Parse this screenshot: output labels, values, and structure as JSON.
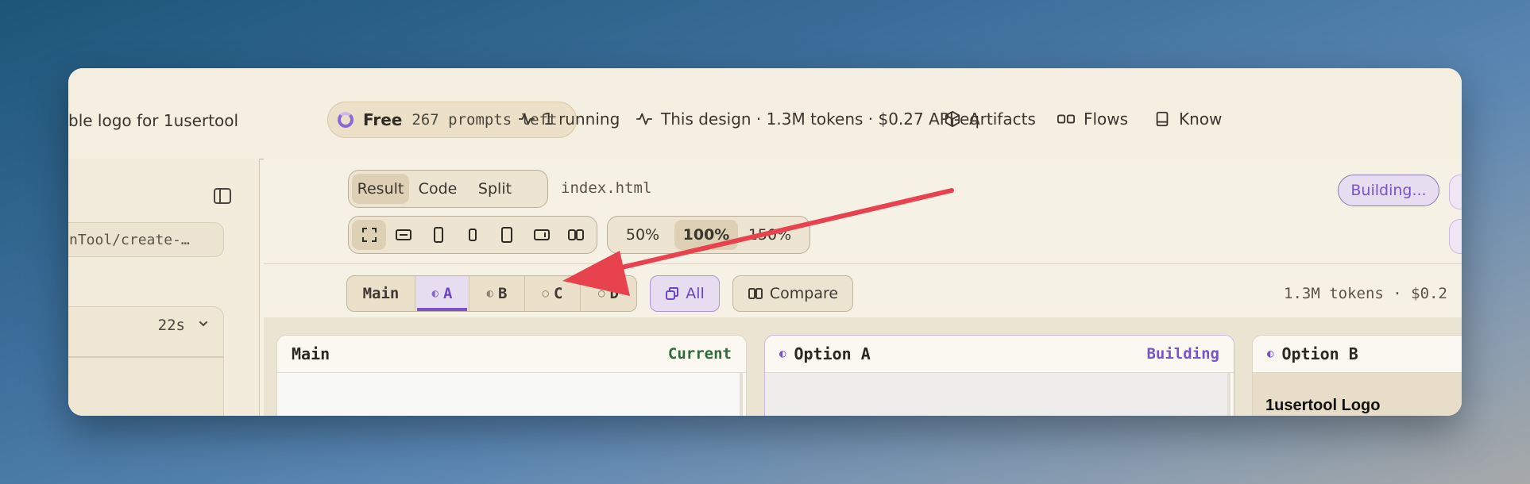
{
  "topbar": {
    "project_title": "ble logo for 1usertool",
    "plan": {
      "name": "Free",
      "remaining": "267 prompts left"
    },
    "running": "1 running",
    "design_stats": "This design · 1.3M tokens · $0.27 API-eq",
    "artifacts": "Artifacts",
    "flows": "Flows",
    "knowledge": "Know"
  },
  "sidebar": {
    "path": "nTool/create-…",
    "run_duration": "22s"
  },
  "toolbar": {
    "view_tabs": [
      "Result",
      "Code",
      "Split"
    ],
    "active_view": "Result",
    "file": "index.html",
    "zoom_options": [
      "50%",
      "100%",
      "150%"
    ],
    "active_zoom": "100%",
    "build_status": "Building...",
    "device_icons": [
      "fullscreen-icon",
      "fit-width-icon",
      "phone-icon",
      "phone-small-icon",
      "tablet-icon",
      "tablet-landscape-icon",
      "dual-pane-icon"
    ]
  },
  "branches": {
    "tabs": [
      {
        "label": "Main",
        "mark": ""
      },
      {
        "label": "A",
        "mark": "◐"
      },
      {
        "label": "B",
        "mark": "◐"
      },
      {
        "label": "C",
        "mark": "○"
      },
      {
        "label": "D",
        "mark": "○"
      }
    ],
    "active": "A",
    "all_label": "All",
    "compare_label": "Compare",
    "token_summary": "1.3M tokens · $0.2"
  },
  "cards": [
    {
      "title": "Main",
      "mark": "",
      "status": "Current",
      "status_color": "#2f6b3a",
      "preview_text": ""
    },
    {
      "title": "Option A",
      "mark": "◐",
      "status": "Building",
      "status_color": "#7a52c9",
      "preview_text": ""
    },
    {
      "title": "Option B",
      "mark": "◐",
      "status": "",
      "status_color": "#2b2822",
      "preview_text": "1usertool Logo"
    }
  ],
  "colors": {
    "accent_purple": "#7a52c9",
    "annotation_arrow": "#e8424f",
    "window_bg": "#f6f1e5"
  }
}
